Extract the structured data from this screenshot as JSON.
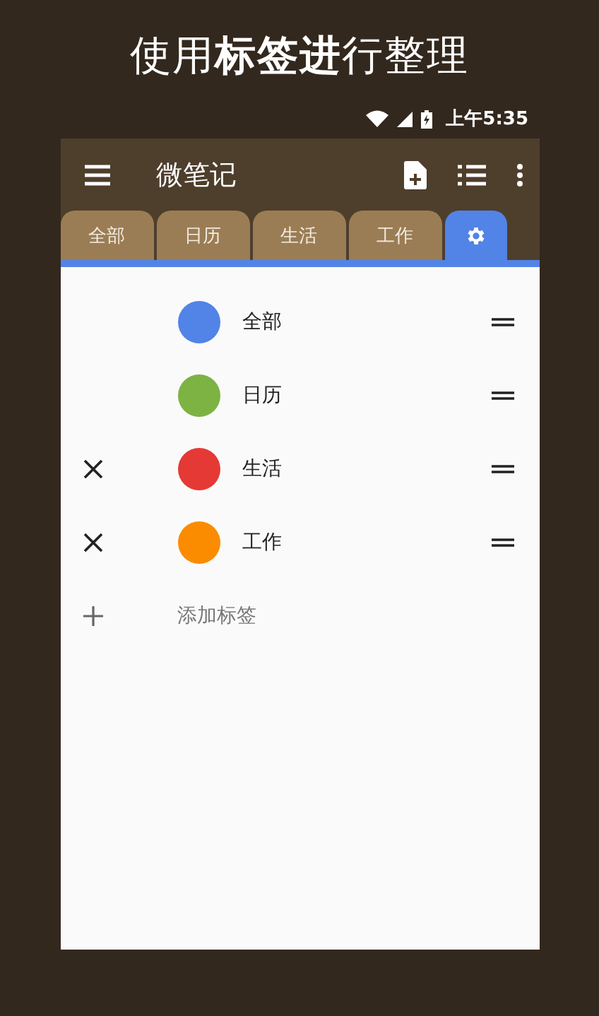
{
  "headline": "使用**标签进**行整理",
  "status_bar": {
    "time": "上午5:35"
  },
  "toolbar": {
    "title": "微笔记"
  },
  "tabs": [
    {
      "kind": "text",
      "label": "全部",
      "selected": false
    },
    {
      "kind": "text",
      "label": "日历",
      "selected": false
    },
    {
      "kind": "text",
      "label": "生活",
      "selected": false
    },
    {
      "kind": "text",
      "label": "工作",
      "selected": false
    },
    {
      "kind": "settings",
      "selected": true
    }
  ],
  "tags": [
    {
      "name": "全部",
      "color": "#5283e6",
      "deletable": false
    },
    {
      "name": "日历",
      "color": "#7cb342",
      "deletable": false
    },
    {
      "name": "生活",
      "color": "#e53935",
      "deletable": true
    },
    {
      "name": "工作",
      "color": "#fb8c00",
      "deletable": true
    }
  ],
  "add_tag": {
    "label": "添加标签"
  }
}
